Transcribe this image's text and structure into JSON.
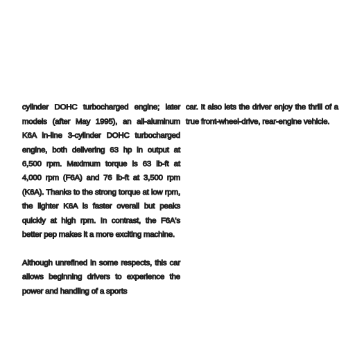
{
  "left_column": {
    "paragraph_1": "cylinder DOHC turbocharged engine; later models (after May 1995), an all-aluminum K6A in-line 3-cylinder DOHC turbocharged engine, both delivering 63 hp in output at 6,500 rpm. Maximum torque is 63 lb-ft at 4,000 rpm (F6A) and 76 lb-ft at 3,500 rpm (K6A). Thanks to the strong torque at low rpm, the lighter K6A is faster overall but peaks quickly at high rpm. In contrast, the F6A's better pep makes it a more exciting machine.",
    "paragraph_2": "Although unrefined in some respects, this car allows beginning drivers to experience the power and handling of a sports"
  },
  "right_column": {
    "paragraph_1": "car. It also lets the driver enjoy the thrill of a true front-wheel-drive, rear-engine vehicle."
  },
  "colors": {
    "text_outline": "#222222",
    "background": "#ffffff"
  }
}
